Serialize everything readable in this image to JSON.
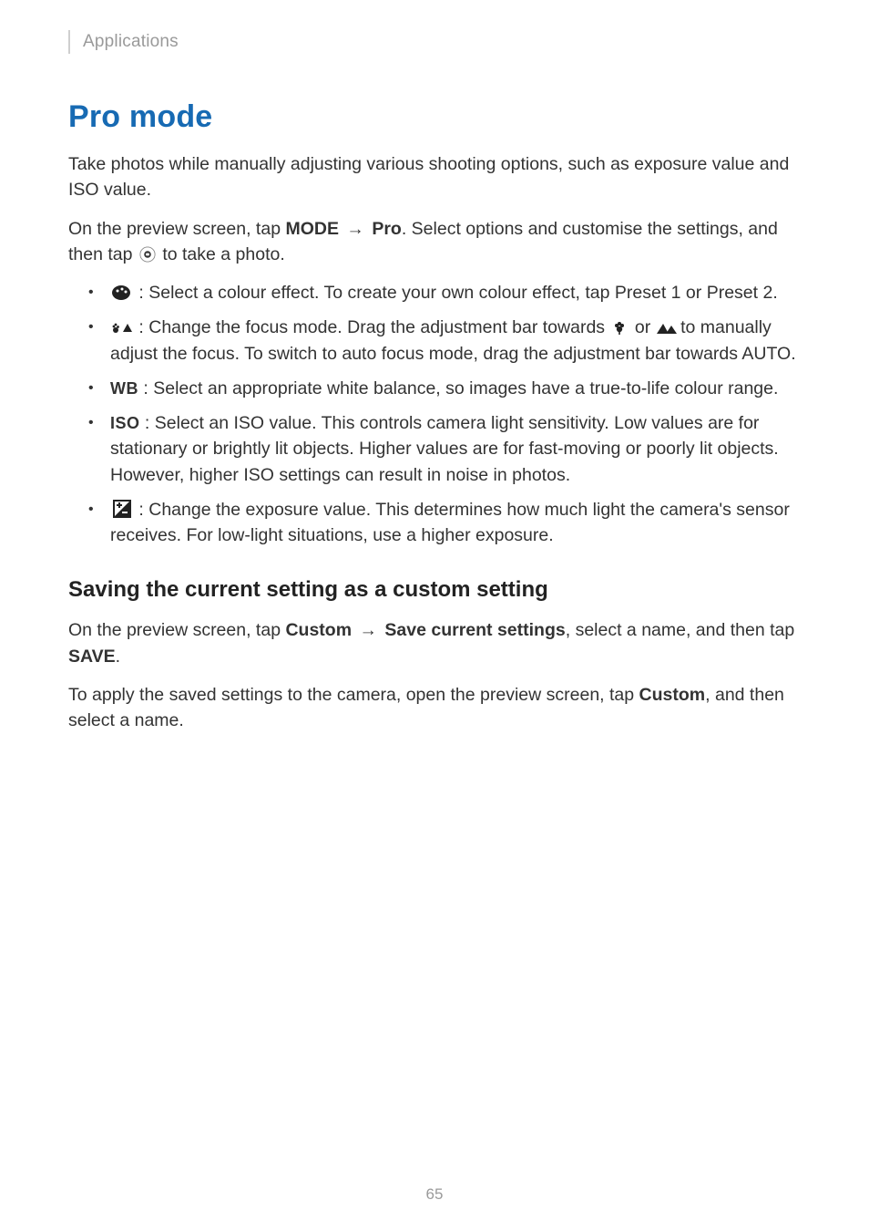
{
  "header": {
    "breadcrumb": "Applications"
  },
  "title": "Pro mode",
  "intro": "Take photos while manually adjusting various shooting options, such as exposure value and ISO value.",
  "instruction": {
    "pre": "On the preview screen, tap ",
    "mode": "MODE",
    "arrow": " → ",
    "pro": "Pro",
    "post": ". Select options and customise the settings, and then tap ",
    "tail": " to take a photo."
  },
  "shutter_icon": "shutter",
  "bullets": [
    {
      "icon_kind": "svg-palette",
      "pre": " : Select a colour effect. To create your own colour effect, tap ",
      "bold1": "Preset 1",
      "mid": " or ",
      "bold2": "Preset 2",
      "post": "."
    },
    {
      "icon_kind": "svg-focus",
      "pre": " : Change the focus mode. Drag the adjustment bar towards ",
      "inline_icon1": "flower",
      "mid1": " or ",
      "inline_icon2": "mountain",
      "mid2": " to manually adjust the focus. To switch to auto focus mode, drag the adjustment bar towards ",
      "bold1": "AUTO",
      "post": "."
    },
    {
      "icon_kind": "text",
      "icon_text": "WB",
      "pre": " : Select an appropriate white balance, so images have a true-to-life colour range."
    },
    {
      "icon_kind": "text",
      "icon_text": "ISO",
      "pre": " : Select an ISO value. This controls camera light sensitivity. Low values are for stationary or brightly lit objects. Higher values are for fast-moving or poorly lit objects. However, higher ISO settings can result in noise in photos."
    },
    {
      "icon_kind": "svg-exposure",
      "pre": " : Change the exposure value. This determines how much light the camera's sensor receives. For low-light situations, use a higher exposure."
    }
  ],
  "section2": {
    "heading": "Saving the current setting as a custom setting",
    "p1": {
      "pre": "On the preview screen, tap ",
      "b1": "Custom",
      "arrow": " → ",
      "b2": "Save current settings",
      "mid": ", select a name, and then tap ",
      "b3": "SAVE",
      "post": "."
    },
    "p2": {
      "pre": "To apply the saved settings to the camera, open the preview screen, tap ",
      "b1": "Custom",
      "post": ", and then select a name."
    }
  },
  "page_number": "65"
}
